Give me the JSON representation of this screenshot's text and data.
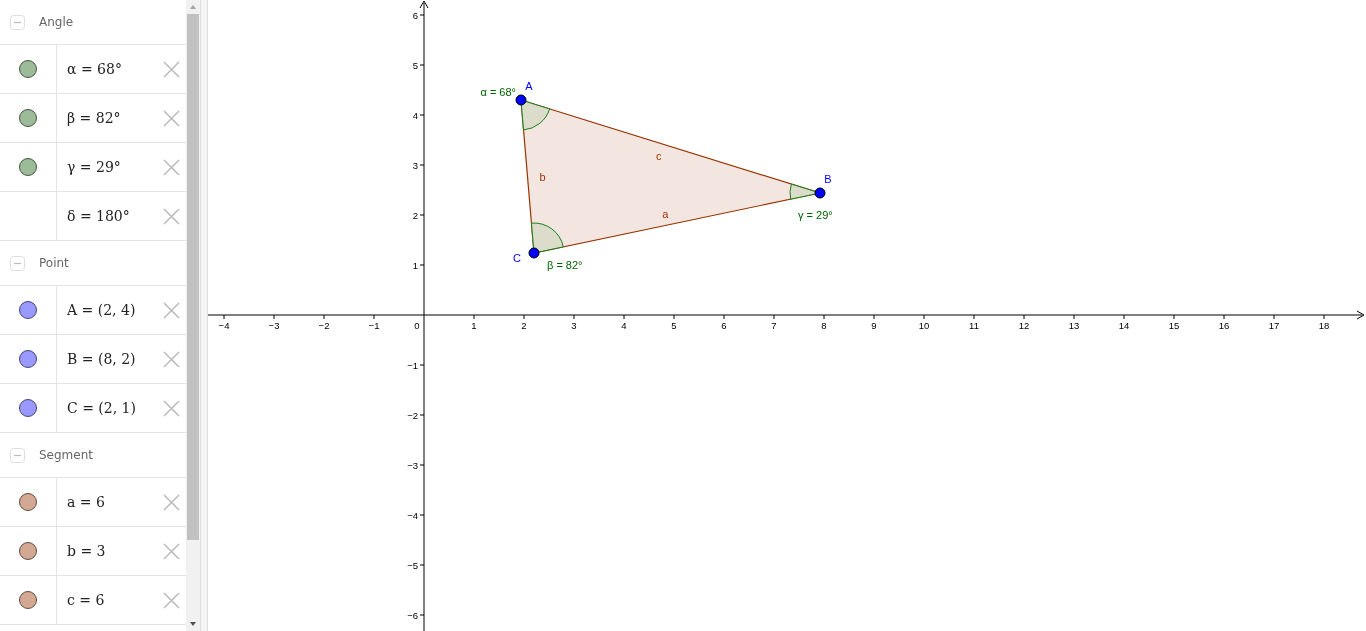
{
  "algebra": {
    "groups": [
      {
        "title": "Angle",
        "expanded": true,
        "items": [
          {
            "text": "α = 68°",
            "shown": true,
            "color": "#9cbb98"
          },
          {
            "text": "β = 82°",
            "shown": true,
            "color": "#9cbb98"
          },
          {
            "text": "γ = 29°",
            "shown": true,
            "color": "#9cbb98"
          },
          {
            "text": "δ = 180°",
            "shown": false
          }
        ]
      },
      {
        "title": "Point",
        "expanded": true,
        "items": [
          {
            "text": "A = (2, 4)",
            "shown": true,
            "color": "#9999ff"
          },
          {
            "text": "B = (8, 2)",
            "shown": true,
            "color": "#9999ff"
          },
          {
            "text": "C = (2, 1)",
            "shown": true,
            "color": "#9999ff"
          }
        ]
      },
      {
        "title": "Segment",
        "expanded": true,
        "items": [
          {
            "text": "a = 6",
            "shown": true,
            "color": "#d4a993"
          },
          {
            "text": "b = 3",
            "shown": true,
            "color": "#d4a993"
          },
          {
            "text": "c = 6",
            "shown": true,
            "color": "#d4a993"
          }
        ]
      }
    ]
  },
  "graphics": {
    "point_labels": [
      "A",
      "B",
      "C"
    ],
    "segment_labels": [
      "a",
      "b",
      "c"
    ],
    "angle_labels": [
      "α = 68°",
      "γ = 29°",
      "β = 82°"
    ],
    "origin_label": "0",
    "chart_data": {
      "type": "scatter",
      "xlim": [
        -4.32,
        18.84
      ],
      "ylim": [
        -6.32,
        6.3
      ],
      "x": [
        1.94,
        7.92,
        2.2
      ],
      "series": [
        {
          "color": "#0000ff",
          "values": [
            4.3,
            2.44,
            1.24
          ]
        }
      ],
      "xticks": [
        {
          "value": -4,
          "label": "−4"
        },
        {
          "value": -3,
          "label": "−3"
        },
        {
          "value": -2,
          "label": "−2"
        },
        {
          "value": -1,
          "label": "−1"
        },
        1,
        2,
        3,
        4,
        5,
        6,
        7,
        8,
        9,
        10,
        11,
        12,
        13,
        14,
        15,
        16,
        17,
        18
      ],
      "yticks": [
        {
          "value": -6,
          "label": "−6"
        },
        {
          "value": -5,
          "label": "−5"
        },
        {
          "value": -4,
          "label": "−4"
        },
        {
          "value": -3,
          "label": "−3"
        },
        {
          "value": -2,
          "label": "−2"
        },
        {
          "value": -1,
          "label": "−1"
        },
        1,
        2,
        3,
        4,
        5,
        6
      ]
    }
  }
}
